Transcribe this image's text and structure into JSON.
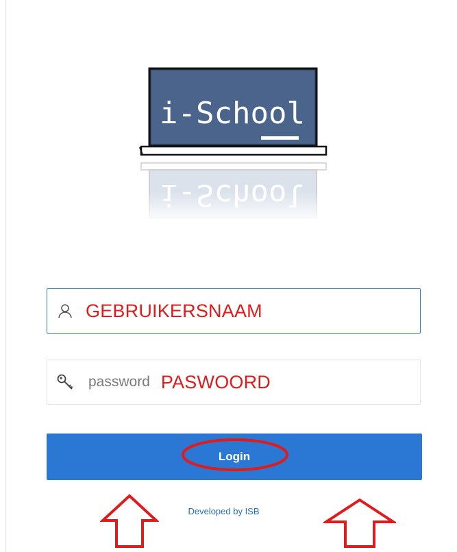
{
  "logo": {
    "brand_text": "i-School",
    "reflection_text": "i-School",
    "icon": "chalkboard-logo"
  },
  "username_field": {
    "icon": "user-icon",
    "annotation": "GEBRUIKERSNAAM"
  },
  "password_field": {
    "icon": "key-icon",
    "placeholder": "password",
    "annotation": "PASWOORD"
  },
  "login_button": {
    "label": "Login"
  },
  "footer": {
    "developed_by": "Developed by ISB"
  },
  "colors": {
    "primary": "#2a77d4",
    "annotation_red": "#e01b1b",
    "chalkboard": "#4a648c",
    "link": "#2a6db8"
  }
}
